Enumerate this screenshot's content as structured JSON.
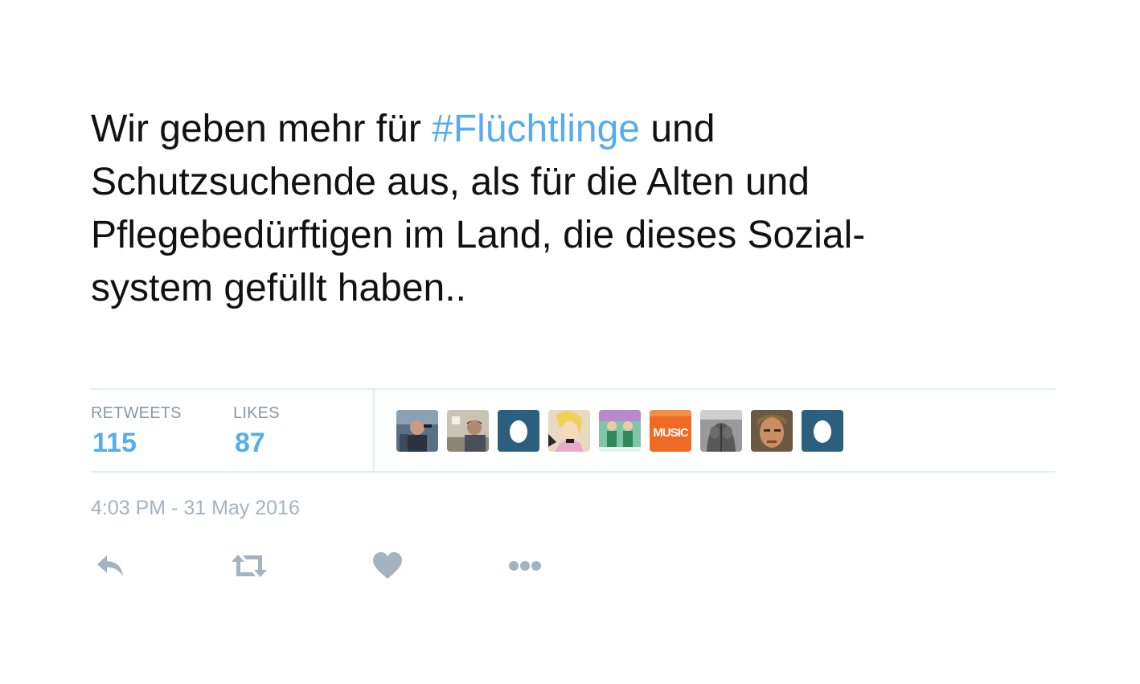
{
  "tweet": {
    "text_line1_before": "Wir geben mehr für ",
    "hashtag": "#Flüchtlinge",
    "text_line1_after": " und",
    "text_line2": "Schutzsuchende aus, als für die Alten und",
    "text_line3": "Pflegebedürftigen im Land, die dieses Sozial-",
    "text_line4": "system gefüllt haben..",
    "hashtag_color": "#55acee"
  },
  "stats": {
    "retweets_label": "RETWEETS",
    "retweets_count": "115",
    "likes_label": "LIKES",
    "likes_count": "87",
    "value_color": "#55acee"
  },
  "likers": [
    {
      "name": "liker-avatar-1",
      "icon": "photo"
    },
    {
      "name": "liker-avatar-2",
      "icon": "photo"
    },
    {
      "name": "liker-avatar-3",
      "icon": "default-egg-icon"
    },
    {
      "name": "liker-avatar-4",
      "icon": "cartoon"
    },
    {
      "name": "liker-avatar-5",
      "icon": "illustration"
    },
    {
      "name": "liker-avatar-6",
      "icon": "music-logo",
      "text": "MUSIC"
    },
    {
      "name": "liker-avatar-7",
      "icon": "photo"
    },
    {
      "name": "liker-avatar-8",
      "icon": "photo"
    },
    {
      "name": "liker-avatar-9",
      "icon": "default-egg-icon"
    }
  ],
  "timestamp": "4:03 PM - 31 May 2016",
  "actions": {
    "reply_icon": "reply-icon",
    "retweet_icon": "retweet-icon",
    "like_icon": "heart-icon",
    "more_icon": "more-icon",
    "icon_color": "#a4b3bf"
  }
}
